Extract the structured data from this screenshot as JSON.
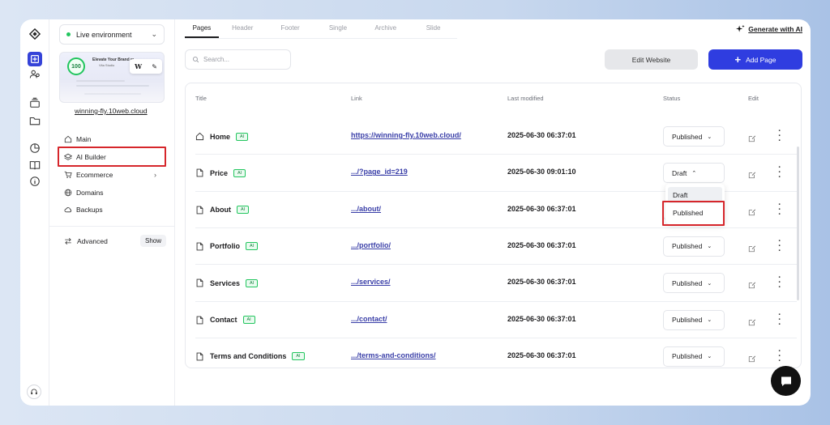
{
  "sidebar": {
    "environment": "Live environment",
    "site_link": "winning-fly.10web.cloud",
    "thumbnail": {
      "score": "100",
      "headline": "Elevate Your Brand w",
      "subline": "Vita Studio"
    },
    "nav": [
      {
        "label": "Main",
        "icon": "home-icon"
      },
      {
        "label": "AI Builder",
        "icon": "layers-icon"
      },
      {
        "label": "Ecommerce",
        "icon": "cart-icon"
      },
      {
        "label": "Domains",
        "icon": "globe-icon"
      },
      {
        "label": "Backups",
        "icon": "cloud-icon"
      }
    ],
    "advanced": {
      "label": "Advanced",
      "toggle": "Show"
    }
  },
  "tabs": [
    "Pages",
    "Header",
    "Footer",
    "Single",
    "Archive",
    "Slide"
  ],
  "active_tab": "Pages",
  "toolbar": {
    "generate": "Generate with AI",
    "search_placeholder": "Search...",
    "edit_website": "Edit Website",
    "add_page": "Add Page"
  },
  "table": {
    "headers": {
      "title": "Title",
      "link": "Link",
      "modified": "Last modified",
      "status": "Status",
      "edit": "Edit"
    },
    "ai_badge": "AI",
    "rows": [
      {
        "title": "Home",
        "icon": "home-icon",
        "link": "https://winning-fly.10web.cloud/",
        "modified": "2025-06-30 06:37:01",
        "status": "Published"
      },
      {
        "title": "Price",
        "icon": "page-icon",
        "link": ".../?page_id=219",
        "modified": "2025-06-30 09:01:10",
        "status": "Draft"
      },
      {
        "title": "About",
        "icon": "page-icon",
        "link": ".../about/",
        "modified": "2025-06-30 06:37:01",
        "status": "Published"
      },
      {
        "title": "Portfolio",
        "icon": "page-icon",
        "link": ".../portfolio/",
        "modified": "2025-06-30 06:37:01",
        "status": "Published"
      },
      {
        "title": "Services",
        "icon": "page-icon",
        "link": ".../services/",
        "modified": "2025-06-30 06:37:01",
        "status": "Published"
      },
      {
        "title": "Contact",
        "icon": "page-icon",
        "link": ".../contact/",
        "modified": "2025-06-30 06:37:01",
        "status": "Published"
      },
      {
        "title": "Terms and Conditions",
        "icon": "page-icon",
        "link": ".../terms-and-conditions/",
        "modified": "2025-06-30 06:37:01",
        "status": "Published"
      }
    ]
  },
  "status_dropdown": {
    "options": [
      "Draft",
      "Published"
    ],
    "highlighted": "Published"
  },
  "colors": {
    "accent": "#2f3de0",
    "highlight": "#d6262b",
    "ai_badge": "#22c55e"
  }
}
